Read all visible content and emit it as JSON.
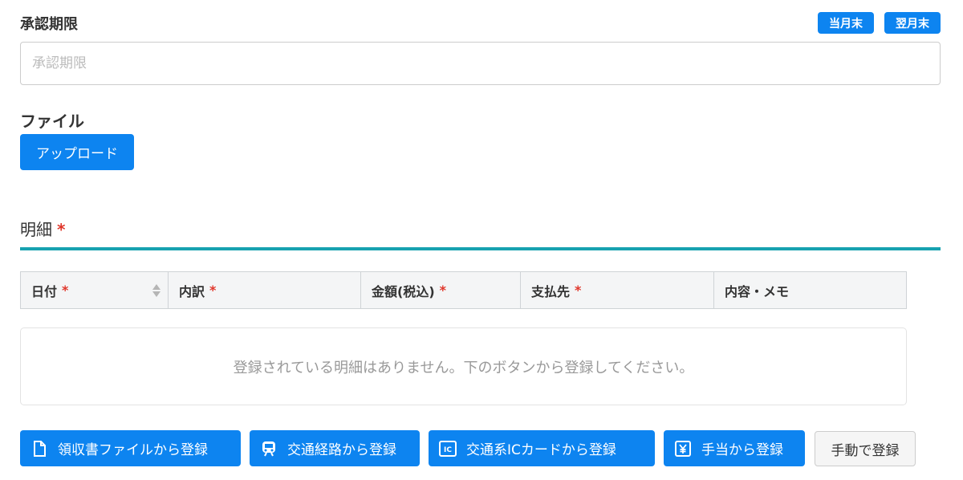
{
  "approval": {
    "label": "承認期限",
    "placeholder": "承認期限",
    "month_end_label": "当月末",
    "next_month_end_label": "翌月末"
  },
  "file": {
    "label": "ファイル",
    "upload_label": "アップロード"
  },
  "details": {
    "heading": "明細",
    "required_mark": "*",
    "columns": [
      {
        "label": "日付",
        "required": true
      },
      {
        "label": "内訳",
        "required": true
      },
      {
        "label": "金額(税込)",
        "required": true
      },
      {
        "label": "支払先",
        "required": true
      },
      {
        "label": "内容・メモ",
        "required": false
      }
    ],
    "empty_message": "登録されている明細はありません。下のボタンから登録してください。"
  },
  "actions": {
    "receipt_label": "領収書ファイルから登録",
    "transit_route_label": "交通経路から登録",
    "transit_ic_label": "交通系ICカードから登録",
    "allowance_label": "手当から登録",
    "manual_label": "手動で登録"
  },
  "icons": {
    "receipt": "file-icon",
    "transit_route": "train-icon",
    "transit_ic": "ic-card-icon",
    "allowance": "yen-icon",
    "sort": "sort-icon"
  },
  "colors": {
    "primary": "#0d84f0",
    "accent_rule": "#17a2b0",
    "required": "#e0362a"
  }
}
